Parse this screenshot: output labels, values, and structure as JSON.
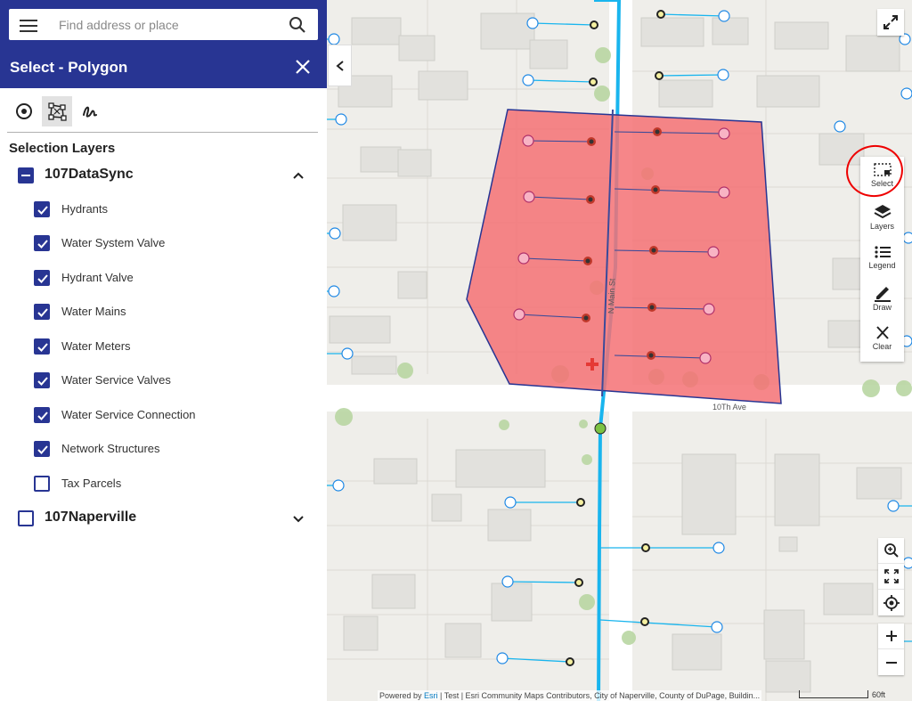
{
  "search": {
    "placeholder": "Find address or place"
  },
  "panel": {
    "title": "Select - Polygon",
    "section_title": "Selection Layers",
    "tools": [
      {
        "name": "point-select",
        "icon": "target-icon"
      },
      {
        "name": "polygon-select",
        "icon": "polygon-select-icon",
        "active": true
      },
      {
        "name": "freehand-select",
        "icon": "freehand-icon"
      }
    ],
    "groups": [
      {
        "label": "107DataSync",
        "state": "partial",
        "expanded": true,
        "layers": [
          {
            "label": "Hydrants",
            "checked": true
          },
          {
            "label": "Water System Valve",
            "checked": true
          },
          {
            "label": "Hydrant Valve",
            "checked": true
          },
          {
            "label": "Water Mains",
            "checked": true
          },
          {
            "label": "Water Meters",
            "checked": true
          },
          {
            "label": "Water Service Valves",
            "checked": true
          },
          {
            "label": "Water Service Connection",
            "checked": true
          },
          {
            "label": "Network Structures",
            "checked": true
          },
          {
            "label": "Tax Parcels",
            "checked": false
          }
        ]
      },
      {
        "label": "107Naperville",
        "state": "unchecked",
        "expanded": false
      }
    ]
  },
  "toolbar": {
    "select": "Select",
    "layers": "Layers",
    "legend": "Legend",
    "draw": "Draw",
    "clear": "Clear"
  },
  "map": {
    "street_main": "N Main St",
    "street_avenue": "10Th Ave",
    "selection_color": "#f47174",
    "water_main_color": "#19b5ee"
  },
  "attribution": {
    "prefix": "Powered by ",
    "esri": "Esri",
    "text": " | Test | Esri Community Maps Contributors, City of Naperville, County of DuPage, Buildin..."
  },
  "scale": {
    "label": "60ft"
  }
}
